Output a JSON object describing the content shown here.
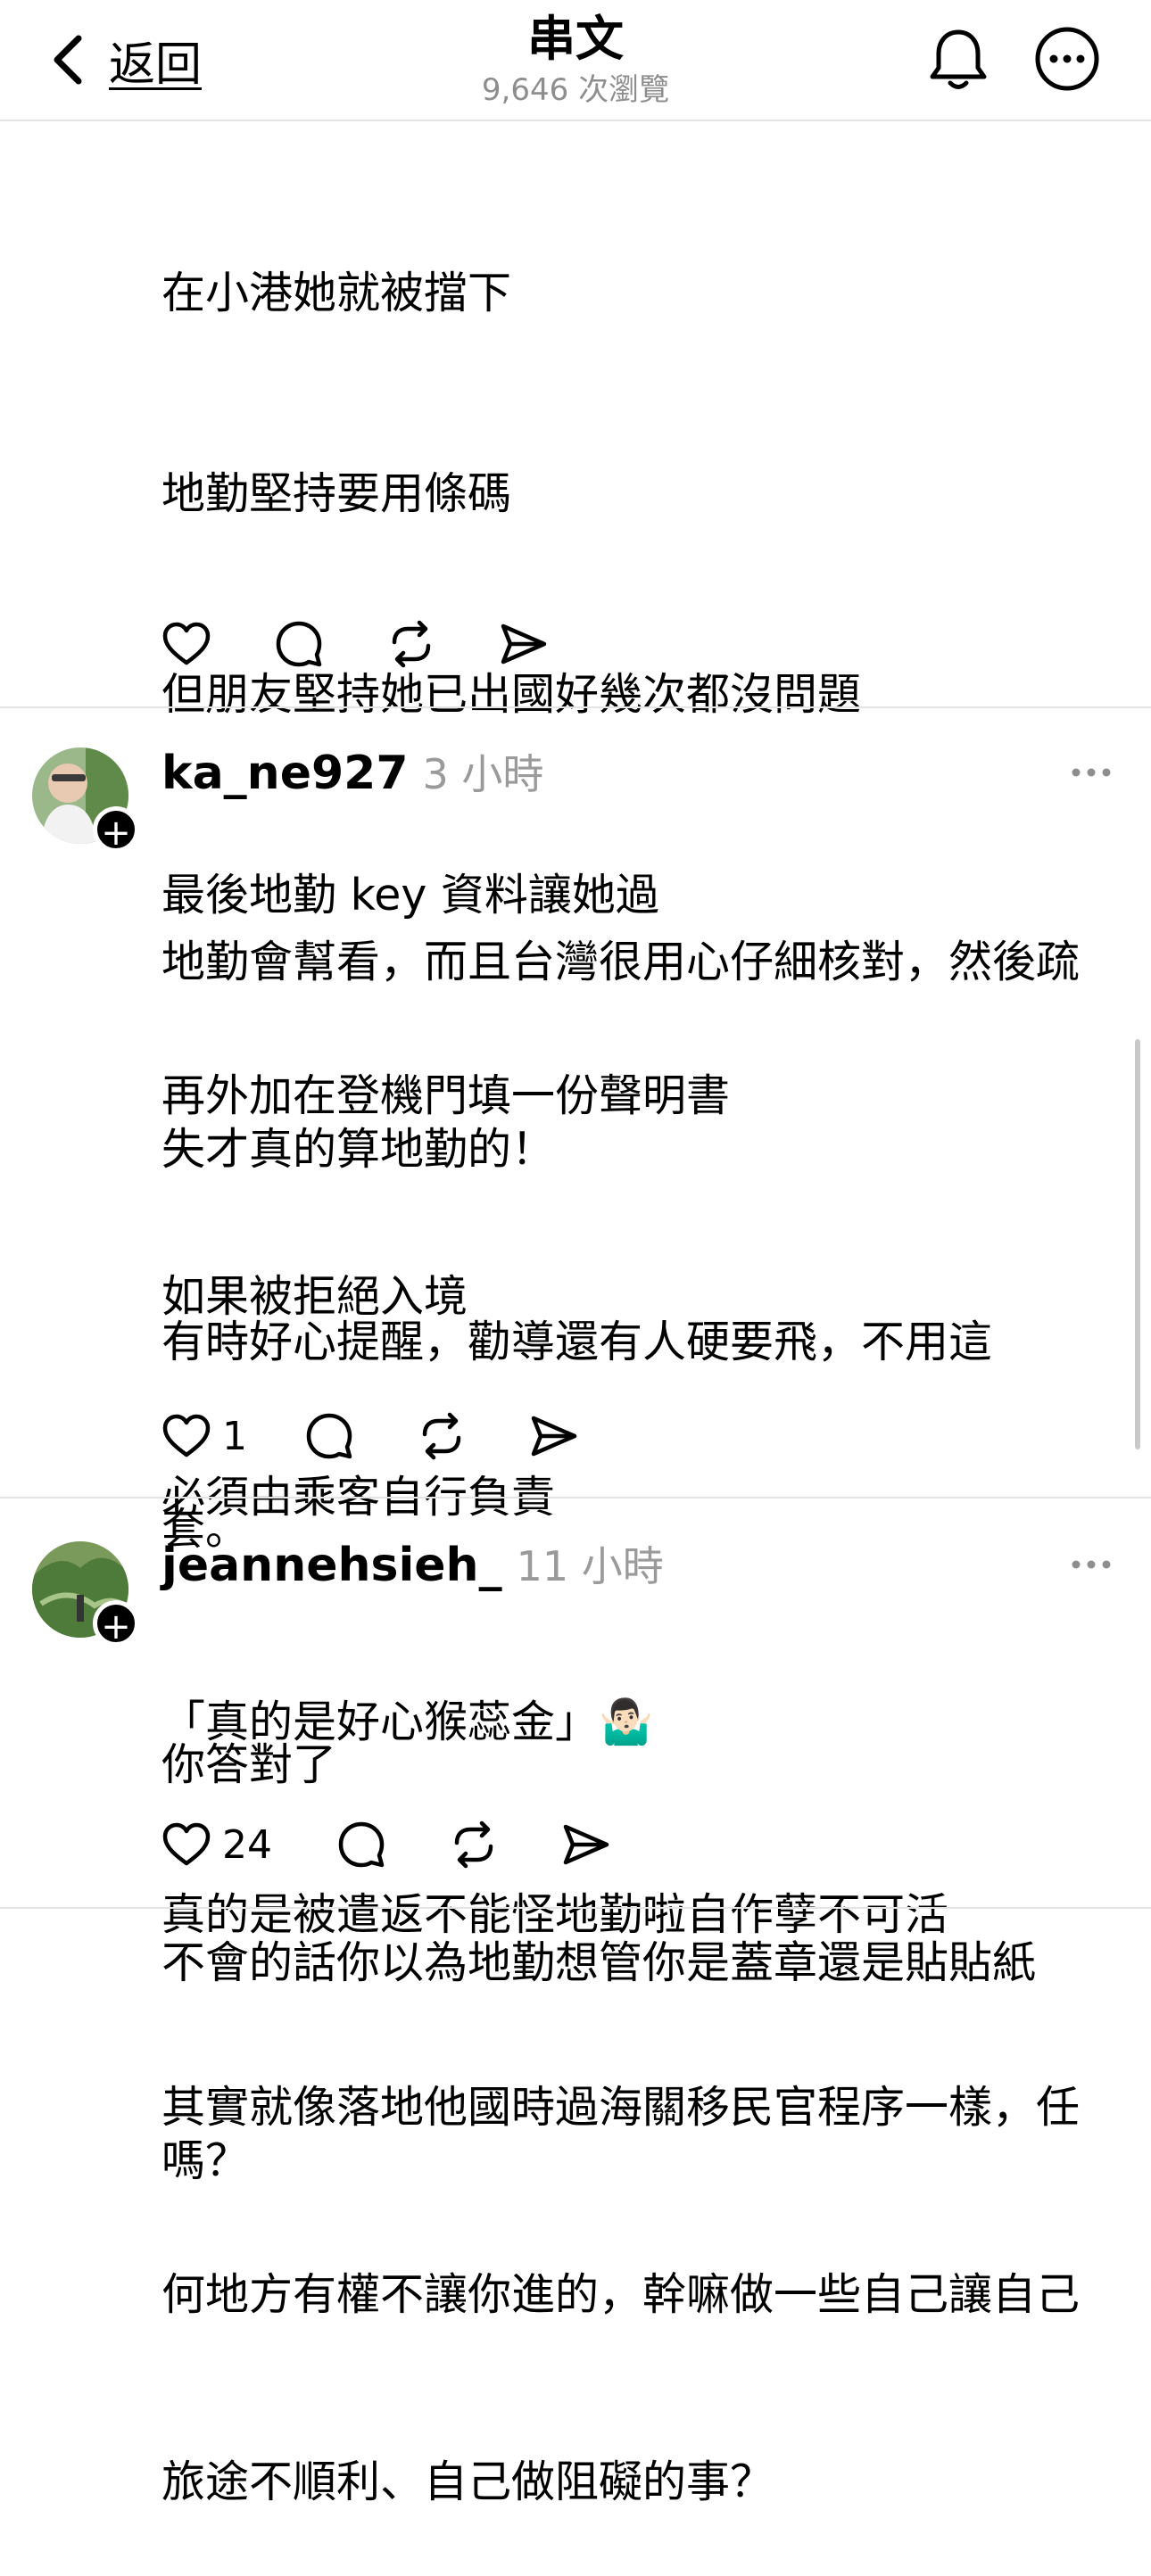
{
  "header": {
    "back_label": "返回",
    "title": "串文",
    "views": "9,646 次瀏覽",
    "icons": [
      "chevron-left-icon",
      "bell-icon",
      "more-circle-icon"
    ]
  },
  "post": {
    "lines": [
      "在小港她就被擋下",
      "地勤堅持要用條碼",
      "但朋友堅持她已出國好幾次都沒問題",
      "最後地勤 key 資料讓她過",
      "再外加在登機門填一份聲明書",
      "如果被拒絕入境",
      "必須由乘客自行負責"
    ]
  },
  "comments": [
    {
      "username": "ka_ne927",
      "time": "3 小時",
      "lines": [
        "地勤會幫看，而且台灣很用心仔細核對，然後疏",
        "失才真的算地勤的！",
        "有時好心提醒，勸導還有人硬要飛，不用這",
        "套。",
        "「真的是好心猴蕊金」🤷🏻‍♂️",
        "真的是被遣返不能怪地勤啦自作孽不可活",
        "其實就像落地他國時過海關移民官程序一樣，任",
        "何地方有權不讓你進的，幹嘛做一些自己讓自己",
        "旅途不順利、自己做阻礙的事？"
      ],
      "likes": "1"
    },
    {
      "username": "jeannehsieh_",
      "time": "11 小時",
      "lines": [
        "你答對了",
        "不會的話你以為地勤想管你是蓋章還是貼貼紙",
        "嗎？"
      ],
      "likes": "24"
    }
  ],
  "colors": {
    "muted": "#8e8e8e",
    "divider": "#e4e4e4",
    "text": "#000000"
  }
}
